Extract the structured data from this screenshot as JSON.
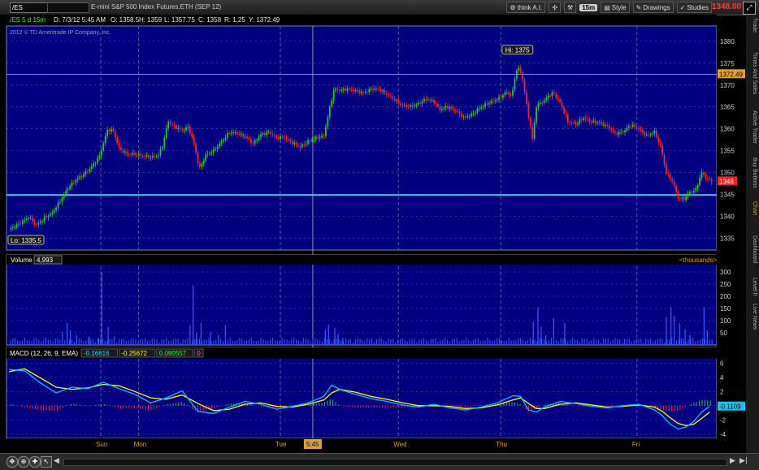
{
  "toolbar": {
    "symbol": "/ES",
    "chart_name": "E-mini S&P 500 Index Futures,ETH (SEP 12)",
    "think_label": "think A.I.",
    "interval": "15m",
    "style_label": "Style",
    "drawings_label": "Drawings",
    "studies_label": "Studies",
    "last_price": "1348.00"
  },
  "info": {
    "symbol_desc": "/ES 5 d 15m",
    "date": "D: 7/3/12 5:45 AM",
    "open": "O: 1358.5",
    "high": "H: 1359",
    "low": "L: 1357.75",
    "close": "C: 1358",
    "range": "R: 1.25",
    "y": "Y: 1372.49"
  },
  "watermark": "2012 © TD Ameritrade IP Company, Inc.",
  "sidebar_tabs": [
    "Trade",
    "Times And Sales",
    "Active Trader",
    "Buy Buttons",
    "Chart",
    "Dashboard",
    "Level II",
    "Live News"
  ],
  "colors": {
    "bg": "#000080",
    "up": "#22cc22",
    "down": "#ff2020",
    "grid": "#5a5a9a",
    "cyan": "#00ffff",
    "volume": "#3355ff",
    "macd": "#00c0ff",
    "avg": "#ffff00"
  },
  "chart_data": [
    {
      "type": "line",
      "price_axis": {
        "ticks": [
          1335,
          1340,
          1345,
          1350,
          1355,
          1360,
          1365,
          1370,
          1375,
          1380
        ],
        "ylim": [
          1332.3,
          1383.5
        ]
      },
      "x_labels": [
        "Sun",
        "Mon",
        "Tue",
        "Wed",
        "Thu",
        "Fri"
      ],
      "crosshair_time": "5:45",
      "price_path": [
        [
          0,
          1337
        ],
        [
          1.2,
          1338.2
        ],
        [
          2.5,
          1339.8
        ],
        [
          3.5,
          1338
        ],
        [
          4.5,
          1339.6
        ],
        [
          5.5,
          1340.8
        ],
        [
          6.5,
          1343.5
        ],
        [
          7.5,
          1346.5
        ],
        [
          8.5,
          1348.3
        ],
        [
          9.5,
          1349.6
        ],
        [
          10.5,
          1351.3
        ],
        [
          11.5,
          1353.8
        ],
        [
          12.5,
          1359.7
        ],
        [
          13.2,
          1359.7
        ],
        [
          14,
          1355.5
        ],
        [
          15,
          1354.2
        ],
        [
          16,
          1354.2
        ],
        [
          17,
          1353.8
        ],
        [
          18,
          1353.5
        ],
        [
          19,
          1354
        ],
        [
          19.6,
          1356.6
        ],
        [
          20.2,
          1361.7
        ],
        [
          21,
          1360.5
        ],
        [
          22,
          1359.6
        ],
        [
          22.8,
          1360.5
        ],
        [
          23.5,
          1356.6
        ],
        [
          24.2,
          1350.8
        ],
        [
          25,
          1354
        ],
        [
          26,
          1355
        ],
        [
          27,
          1357.1
        ],
        [
          28,
          1359.2
        ],
        [
          29,
          1359
        ],
        [
          30,
          1358.2
        ],
        [
          31,
          1356.6
        ],
        [
          32,
          1358.7
        ],
        [
          33,
          1359.2
        ],
        [
          34,
          1358
        ],
        [
          35,
          1358
        ],
        [
          36,
          1356.8
        ],
        [
          37,
          1355.9
        ],
        [
          38,
          1357.1
        ],
        [
          39,
          1357.9
        ],
        [
          40,
          1358.4
        ],
        [
          40.7,
          1364.4
        ],
        [
          41.3,
          1369.1
        ],
        [
          42,
          1368.8
        ],
        [
          43,
          1369.1
        ],
        [
          44,
          1368.7
        ],
        [
          45,
          1368.2
        ],
        [
          46,
          1369.1
        ],
        [
          47,
          1369.1
        ],
        [
          48.5,
          1367.3
        ],
        [
          50,
          1365.3
        ],
        [
          51,
          1365.1
        ],
        [
          52,
          1365.7
        ],
        [
          53,
          1366.9
        ],
        [
          54,
          1366.2
        ],
        [
          54.7,
          1364.4
        ],
        [
          55.6,
          1365.1
        ],
        [
          56.8,
          1364.1
        ],
        [
          57.8,
          1362.5
        ],
        [
          58.8,
          1363.3
        ],
        [
          59.8,
          1364.8
        ],
        [
          61,
          1366
        ],
        [
          62.2,
          1366.9
        ],
        [
          63.2,
          1368.4
        ],
        [
          63.9,
          1367.4
        ],
        [
          64.3,
          1372.4
        ],
        [
          64.7,
          1374.1
        ],
        [
          65.2,
          1372
        ],
        [
          65.6,
          1367
        ],
        [
          66,
          1362.9
        ],
        [
          66.5,
          1357.7
        ],
        [
          67,
          1365.2
        ],
        [
          68,
          1366.5
        ],
        [
          68.5,
          1367.5
        ],
        [
          69.2,
          1368.2
        ],
        [
          70,
          1366
        ],
        [
          71,
          1361.7
        ],
        [
          72,
          1361.1
        ],
        [
          73,
          1362.5
        ],
        [
          74,
          1361.6
        ],
        [
          75,
          1361.4
        ],
        [
          76,
          1360.6
        ],
        [
          77,
          1358.9
        ],
        [
          78,
          1359.3
        ],
        [
          79,
          1360.9
        ],
        [
          80,
          1360
        ],
        [
          81,
          1358.4
        ],
        [
          82,
          1359.3
        ],
        [
          82.8,
          1355.8
        ],
        [
          83.5,
          1349.9
        ],
        [
          84.3,
          1347.9
        ],
        [
          85,
          1344.3
        ],
        [
          85.7,
          1343.9
        ],
        [
          86.4,
          1345.4
        ],
        [
          87.2,
          1345.9
        ],
        [
          88,
          1350
        ],
        [
          88.7,
          1348.5
        ],
        [
          89.4,
          1348
        ]
      ],
      "hi_label": "Hi: 1375",
      "lo_label": "Lo: 1335.5",
      "price_bubble": "1348",
      "y_bubble": "1372.49",
      "horizontal_line_value": 1344.9
    },
    {
      "type": "bar",
      "title": "Volume",
      "value": "4,993",
      "units": "<thousands>",
      "ticks": [
        50,
        100,
        150,
        200,
        250,
        300
      ],
      "ylim": [
        0,
        330
      ],
      "spikes": [
        [
          6.8,
          55
        ],
        [
          7.4,
          90
        ],
        [
          7.8,
          60
        ],
        [
          8.6,
          40
        ],
        [
          10.2,
          35
        ],
        [
          11.4,
          30
        ],
        [
          11.8,
          300
        ],
        [
          12.6,
          75
        ],
        [
          13.4,
          35
        ],
        [
          23,
          80
        ],
        [
          23.4,
          245
        ],
        [
          23.8,
          50
        ],
        [
          24.4,
          90
        ],
        [
          25.6,
          55
        ],
        [
          26.6,
          40
        ],
        [
          27.5,
          80
        ],
        [
          40.2,
          65
        ],
        [
          40.6,
          85
        ],
        [
          41.4,
          70
        ],
        [
          41.8,
          45
        ],
        [
          42.4,
          30
        ],
        [
          66.6,
          95
        ],
        [
          67.2,
          155
        ],
        [
          67.6,
          75
        ],
        [
          68.2,
          40
        ],
        [
          69.2,
          110
        ],
        [
          70.6,
          90
        ],
        [
          83.5,
          115
        ],
        [
          84.1,
          155
        ],
        [
          84.5,
          120
        ],
        [
          85.2,
          90
        ],
        [
          85.9,
          65
        ],
        [
          86.5,
          40
        ],
        [
          88.3,
          155
        ],
        [
          88.7,
          60
        ]
      ]
    },
    {
      "type": "line",
      "title": "MACD (12, 26, 9, EMA)",
      "values_text": [
        "-0.16616",
        "-0.25672",
        "0.090557",
        "0"
      ],
      "ticks": [
        -4,
        -2,
        0,
        2,
        4,
        6
      ],
      "ylim": [
        -4.6,
        6.6
      ],
      "value_bubble": "-0.1109",
      "macd_path": [
        [
          0,
          5.1
        ],
        [
          2,
          4.9
        ],
        [
          4,
          3.2
        ],
        [
          6,
          1.8
        ],
        [
          8,
          2.6
        ],
        [
          10,
          2.4
        ],
        [
          12,
          3.3
        ],
        [
          14,
          2.4
        ],
        [
          16,
          1.6
        ],
        [
          18,
          0.4
        ],
        [
          20,
          1.1
        ],
        [
          22,
          2.1
        ],
        [
          24,
          -0.8
        ],
        [
          26,
          -1.1
        ],
        [
          28,
          -0.2
        ],
        [
          30,
          0.6
        ],
        [
          32,
          0.2
        ],
        [
          34,
          -0.5
        ],
        [
          36,
          -0.1
        ],
        [
          38,
          0.4
        ],
        [
          40,
          1.3
        ],
        [
          41,
          2.9
        ],
        [
          42,
          2.3
        ],
        [
          44,
          1.6
        ],
        [
          46,
          1.0
        ],
        [
          48,
          0.6
        ],
        [
          50,
          0.1
        ],
        [
          52,
          -0.2
        ],
        [
          54,
          0.2
        ],
        [
          56,
          -0.3
        ],
        [
          58,
          -0.6
        ],
        [
          60,
          -0.2
        ],
        [
          62,
          0.4
        ],
        [
          64,
          1.4
        ],
        [
          65,
          1.3
        ],
        [
          66,
          -0.6
        ],
        [
          67,
          -0.9
        ],
        [
          68,
          -0.2
        ],
        [
          70,
          0.6
        ],
        [
          72,
          0.3
        ],
        [
          74,
          -0.1
        ],
        [
          76,
          -0.3
        ],
        [
          78,
          0.0
        ],
        [
          80,
          0.2
        ],
        [
          82,
          -0.6
        ],
        [
          83,
          -1.4
        ],
        [
          84,
          -2.6
        ],
        [
          85,
          -3.3
        ],
        [
          86,
          -3.0
        ],
        [
          87,
          -2.2
        ],
        [
          88,
          -0.9
        ],
        [
          89,
          -0.1
        ]
      ],
      "avg_path": [
        [
          0,
          4.8
        ],
        [
          2,
          5.2
        ],
        [
          4,
          3.9
        ],
        [
          6,
          2.6
        ],
        [
          8,
          2.3
        ],
        [
          10,
          2.5
        ],
        [
          12,
          3.0
        ],
        [
          14,
          2.8
        ],
        [
          16,
          2.0
        ],
        [
          18,
          1.1
        ],
        [
          20,
          0.9
        ],
        [
          22,
          1.5
        ],
        [
          24,
          0.3
        ],
        [
          26,
          -0.7
        ],
        [
          28,
          -0.5
        ],
        [
          30,
          0.2
        ],
        [
          32,
          0.4
        ],
        [
          34,
          -0.1
        ],
        [
          36,
          -0.2
        ],
        [
          38,
          0.2
        ],
        [
          40,
          0.8
        ],
        [
          41,
          1.8
        ],
        [
          42,
          2.3
        ],
        [
          44,
          1.9
        ],
        [
          46,
          1.3
        ],
        [
          48,
          0.9
        ],
        [
          50,
          0.4
        ],
        [
          52,
          0.0
        ],
        [
          54,
          0.0
        ],
        [
          56,
          -0.1
        ],
        [
          58,
          -0.4
        ],
        [
          60,
          -0.3
        ],
        [
          62,
          0.1
        ],
        [
          64,
          0.8
        ],
        [
          65,
          1.1
        ],
        [
          66,
          0.3
        ],
        [
          67,
          -0.4
        ],
        [
          68,
          -0.4
        ],
        [
          70,
          0.2
        ],
        [
          72,
          0.4
        ],
        [
          74,
          0.1
        ],
        [
          76,
          -0.2
        ],
        [
          78,
          -0.1
        ],
        [
          80,
          0.1
        ],
        [
          82,
          -0.2
        ],
        [
          83,
          -0.8
        ],
        [
          84,
          -1.7
        ],
        [
          85,
          -2.5
        ],
        [
          86,
          -2.8
        ],
        [
          87,
          -2.6
        ],
        [
          88,
          -1.8
        ],
        [
          89,
          -0.9
        ]
      ]
    }
  ]
}
